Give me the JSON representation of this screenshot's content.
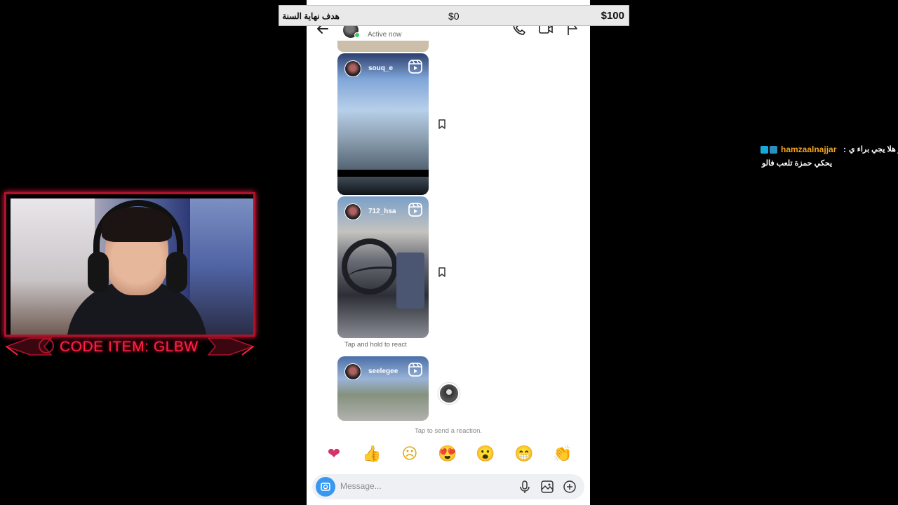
{
  "stream_overlay": {
    "goal": {
      "title": "هدف نهاية السنة",
      "current": "$0",
      "target": "$100"
    },
    "chat": {
      "username": "hamzaalnajjar",
      "separator": ":",
      "message_line1": "و هلا يجي براء ي",
      "message_line2": "يحكي حمزة تلعب فالو"
    },
    "webcam": {
      "banner_text": "CODE ITEM: GLBW",
      "accent_color": "#ff2447"
    }
  },
  "instagram_dm": {
    "header": {
      "active_status": "Active now"
    },
    "messages": [
      {
        "type": "reel",
        "username": "souq_e"
      },
      {
        "type": "reel",
        "username": "712_hsa"
      },
      {
        "type": "reel",
        "username": "seelegee"
      }
    ],
    "tap_hold_hint": "Tap and hold to react",
    "tap_send_hint": "Tap to send a reaction.",
    "reactions": [
      "❤",
      "👍",
      "☹",
      "😍",
      "😮",
      "😁",
      "👏"
    ],
    "composer": {
      "placeholder": "Message..."
    },
    "colors": {
      "accent_blue": "#3897f0",
      "online_green": "#3ccf5a"
    }
  }
}
